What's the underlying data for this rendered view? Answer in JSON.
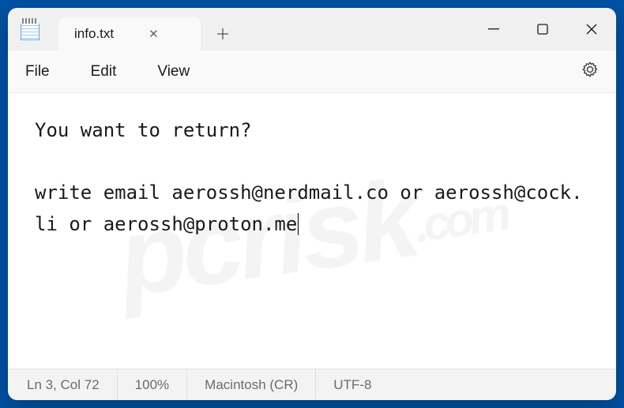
{
  "tab": {
    "title": "info.txt"
  },
  "menu": {
    "file": "File",
    "edit": "Edit",
    "view": "View"
  },
  "content": {
    "line1": "You want to return?",
    "line2": "write email aerossh@nerdmail.co or aerossh@cock.li or aerossh@proton.me"
  },
  "status": {
    "position": "Ln 3, Col 72",
    "zoom": "100%",
    "lineending": "Macintosh (CR)",
    "encoding": "UTF-8"
  },
  "watermark": {
    "text": "pcrisk",
    "suffix": ".com"
  }
}
